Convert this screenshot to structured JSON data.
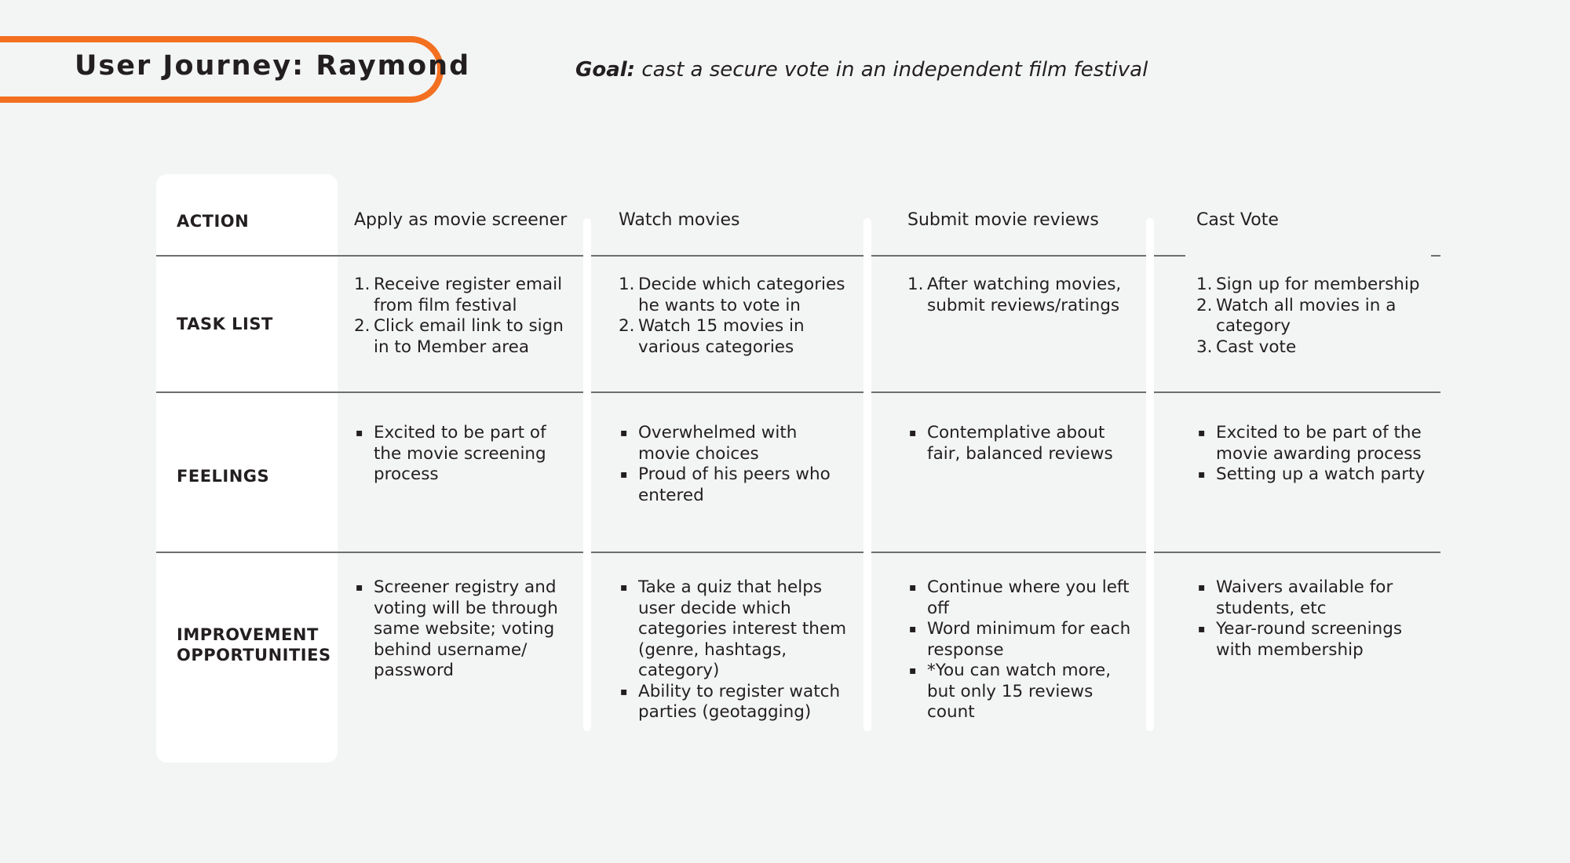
{
  "header": {
    "title": "User Journey: Raymond",
    "goal_label": "Goal:",
    "goal_text": " cast a secure vote in an independent film festival",
    "accent_color": "#f37021"
  },
  "rows": {
    "action": "ACTION",
    "task_list": "TASK LIST",
    "feelings": "FEELINGS",
    "improvement": "IMPROVEMENT OPPORTUNITIES"
  },
  "columns": [
    {
      "action": "Apply as movie screener",
      "tasks": [
        "Receive register email from film festival",
        "Click email link to sign in to Member area"
      ],
      "feelings": [
        "Excited to be part of the movie screening process"
      ],
      "improvements": [
        "Screener registry and voting will be through same website; voting behind username/ password"
      ]
    },
    {
      "action": "Watch movies",
      "tasks": [
        "Decide which categories he wants to vote in",
        "Watch 15 movies in various categories"
      ],
      "feelings": [
        "Overwhelmed with movie choices",
        "Proud of his peers who entered"
      ],
      "improvements": [
        "Take a quiz that helps user decide which categories interest them (genre, hashtags, category)",
        "Ability to register watch parties (geotagging)"
      ]
    },
    {
      "action": "Submit movie reviews",
      "tasks": [
        "After watching movies, submit reviews/ratings"
      ],
      "feelings": [
        "Contemplative about fair, balanced reviews"
      ],
      "improvements": [
        "Continue where you left off",
        "Word minimum for each response",
        "*You can watch more, but only 15 reviews count"
      ]
    },
    {
      "action": "Cast Vote",
      "tasks": [
        "Sign up for membership",
        "Watch all movies in a category",
        "Cast vote"
      ],
      "feelings": [
        "Excited to be part of the movie awarding process",
        "Setting up a watch party"
      ],
      "improvements": [
        "Waivers available for students, etc",
        "Year-round screenings with membership"
      ]
    }
  ],
  "bullet_glyph": "▪"
}
